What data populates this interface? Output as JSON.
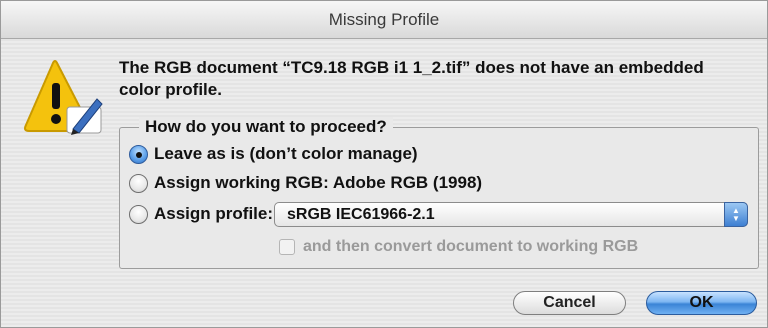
{
  "window": {
    "title": "Missing Profile"
  },
  "icons": {
    "caution": "caution-icon",
    "pen": "pen-icon"
  },
  "message": "The RGB document “TC9.18 RGB i1 1_2.tif” does not have an embedded color profile.",
  "proceed": {
    "legend": "How do you want to proceed?",
    "options": [
      {
        "label": "Leave as is (don’t color manage)",
        "selected": true
      },
      {
        "label": "Assign working RGB:  Adobe RGB (1998)",
        "selected": false
      },
      {
        "label": "Assign profile:",
        "selected": false
      }
    ],
    "profile_value": "sRGB IEC61966-2.1",
    "convert_label": "and then convert document to working RGB",
    "convert_checked": false,
    "convert_enabled": false
  },
  "buttons": {
    "cancel": "Cancel",
    "ok": "OK"
  },
  "colors": {
    "accent": "#3b84d6",
    "warning": "#f4c20d"
  }
}
